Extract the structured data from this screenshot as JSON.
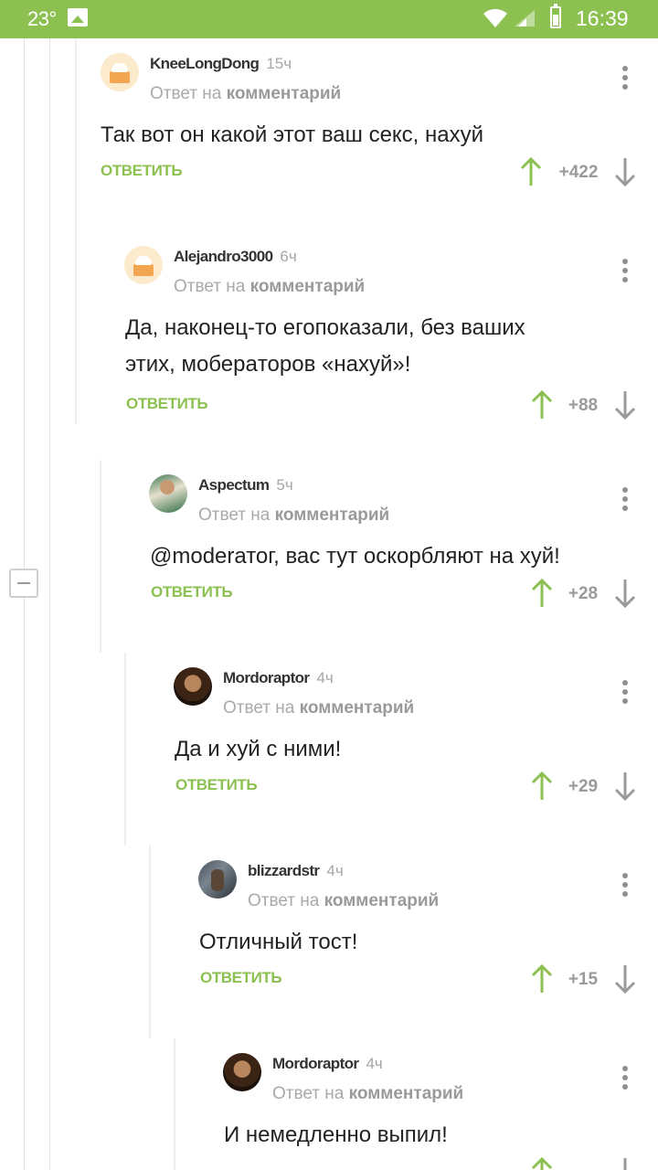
{
  "status_bar": {
    "temperature": "23°",
    "time": "16:39",
    "icons": [
      "gallery-icon",
      "wifi-icon",
      "signal-icon",
      "battery-icon"
    ]
  },
  "colors": {
    "accent": "#8cc152",
    "muted": "#a9a9a9",
    "text": "#222222"
  },
  "comments": [
    {
      "author": "KneeLongDong",
      "time": "15ч",
      "reply_prefix": "Ответ на",
      "reply_link": "комментарий",
      "text": [
        "Так вот он какой этот ваш секс, нахуй"
      ],
      "reply_label": "ОТВЕТИТЬ",
      "score": "+422"
    },
    {
      "author": "Alejandro3000",
      "time": "6ч",
      "reply_prefix": "Ответ на",
      "reply_link": "комментарий",
      "text": [
        "Да, наконец-то егопоказали, без ваших",
        "этих, моберaторов «нахуй»!"
      ],
      "reply_label": "ОТВЕТИТЬ",
      "score": "+88"
    },
    {
      "author": "Aspectum",
      "time": "5ч",
      "reply_prefix": "Ответ на",
      "reply_link": "комментарий",
      "text": [
        "@moderатог, вас тут оскорбляют на хуй!"
      ],
      "reply_label": "ОТВЕТИТЬ",
      "score": "+28"
    },
    {
      "author": "Mordoraptor",
      "time": "4ч",
      "reply_prefix": "Ответ на",
      "reply_link": "комментарий",
      "text": [
        "Да и хуй с ними!"
      ],
      "reply_label": "ОТВЕТИТЬ",
      "score": "+29"
    },
    {
      "author": "blizzardstr",
      "time": "4ч",
      "reply_prefix": "Ответ на",
      "reply_link": "комментарий",
      "text": [
        "Отличный тост!"
      ],
      "reply_label": "ОТВЕТИТЬ",
      "score": "+15"
    },
    {
      "author": "Mordoraptor",
      "time": "4ч",
      "reply_prefix": "Ответ на",
      "reply_link": "комментарий",
      "text": [
        "И немедленно выпил!"
      ],
      "reply_label": "ОТВЕТИТЬ",
      "score": ""
    }
  ]
}
